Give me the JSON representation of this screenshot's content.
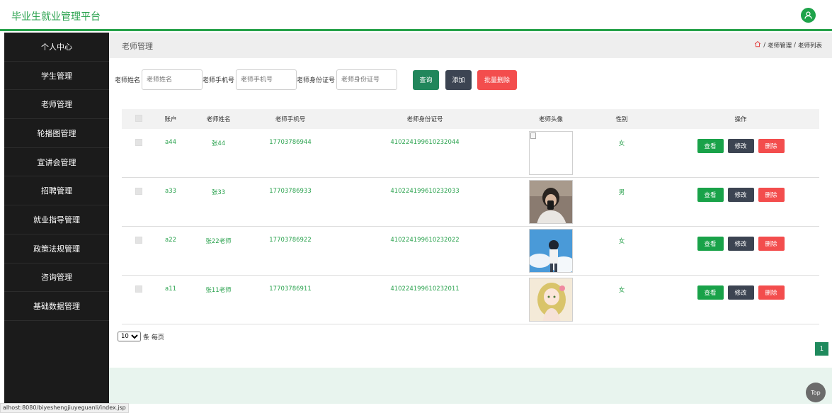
{
  "app": {
    "title": "毕业生就业管理平台"
  },
  "sidebar": {
    "items": [
      {
        "label": "个人中心"
      },
      {
        "label": "学生管理"
      },
      {
        "label": "老师管理"
      },
      {
        "label": "轮播图管理"
      },
      {
        "label": "宣讲会管理"
      },
      {
        "label": "招聘管理"
      },
      {
        "label": "就业指导管理"
      },
      {
        "label": "政策法规管理"
      },
      {
        "label": "咨询管理"
      },
      {
        "label": "基础数据管理"
      }
    ]
  },
  "page": {
    "title": "老师管理",
    "breadcrumb": {
      "home_icon": "home-icon",
      "separator": "/",
      "level1": "老师管理",
      "level2": "老师列表"
    }
  },
  "search": {
    "name_label": "老师姓名",
    "name_placeholder": "老师姓名",
    "phone_label": "老师手机号",
    "phone_placeholder": "老师手机号",
    "idcard_label": "老师身份证号",
    "idcard_placeholder": "老师身份证号",
    "query_label": "查询",
    "add_label": "添加",
    "batch_delete_label": "批量删除"
  },
  "table": {
    "headers": {
      "account": "账户",
      "name": "老师姓名",
      "phone": "老师手机号",
      "idcard": "老师身份证号",
      "avatar": "老师头像",
      "gender": "性别",
      "actions": "操作"
    },
    "action_labels": {
      "view": "查看",
      "edit": "修改",
      "delete": "删除"
    },
    "rows": [
      {
        "account": "a44",
        "name": "张44",
        "phone": "17703786944",
        "idcard": "410224199610232044",
        "avatar": "broken-image",
        "gender": "女"
      },
      {
        "account": "a33",
        "name": "张33",
        "phone": "17703786933",
        "idcard": "410224199610232033",
        "avatar": "person-photo",
        "gender": "男"
      },
      {
        "account": "a22",
        "name": "张22老师",
        "phone": "17703786922",
        "idcard": "410224199610232022",
        "avatar": "anime-sky-photo",
        "gender": "女"
      },
      {
        "account": "a11",
        "name": "张11老师",
        "phone": "17703786911",
        "idcard": "410224199610232011",
        "avatar": "anime-girl-photo",
        "gender": "女"
      }
    ]
  },
  "pagination": {
    "page_size": "10",
    "per_page_label": "条 每页",
    "current_page": "1"
  },
  "top_button": {
    "label": "Top"
  },
  "status_bar": {
    "url": "alhost:8080/biyeshengjiuyeguanli/index.jsp"
  },
  "colors": {
    "brand_green": "#25a149",
    "sidebar_bg": "#1b1b1b",
    "delete_red": "#f34d4d",
    "edit_dark": "#3c4452"
  }
}
